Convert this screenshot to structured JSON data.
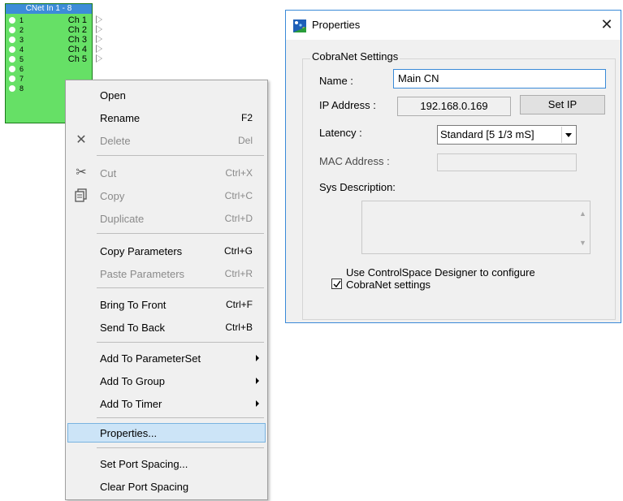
{
  "block": {
    "title": "CNet In 1 - 8",
    "ports": [
      {
        "num": "1",
        "out": "Ch 1"
      },
      {
        "num": "2",
        "out": "Ch 2"
      },
      {
        "num": "3",
        "out": "Ch 3"
      },
      {
        "num": "4",
        "out": "Ch 4"
      },
      {
        "num": "5",
        "out": "Ch 5"
      },
      {
        "num": "6",
        "out": ""
      },
      {
        "num": "7",
        "out": ""
      },
      {
        "num": "8",
        "out": ""
      }
    ]
  },
  "menu": {
    "open": "Open",
    "rename": "Rename",
    "rename_sc": "F2",
    "delete": "Delete",
    "delete_sc": "Del",
    "cut": "Cut",
    "cut_sc": "Ctrl+X",
    "copy": "Copy",
    "copy_sc": "Ctrl+C",
    "duplicate": "Duplicate",
    "duplicate_sc": "Ctrl+D",
    "copy_params": "Copy Parameters",
    "copy_params_sc": "Ctrl+G",
    "paste_params": "Paste Parameters",
    "paste_params_sc": "Ctrl+R",
    "bring_front": "Bring To Front",
    "bring_front_sc": "Ctrl+F",
    "send_back": "Send To Back",
    "send_back_sc": "Ctrl+B",
    "add_paramset": "Add To ParameterSet",
    "add_group": "Add To Group",
    "add_timer": "Add To Timer",
    "properties": "Properties...",
    "set_spacing": "Set Port Spacing...",
    "clear_spacing": "Clear Port Spacing"
  },
  "dialog": {
    "title": "Properties",
    "close": "✕",
    "group_label": "CobraNet Settings",
    "name_label": "Name :",
    "name_value": "Main CN",
    "ip_label": "IP Address :",
    "ip_value": "192.168.0.169",
    "set_ip": "Set IP",
    "latency_label": "Latency :",
    "latency_value": "Standard [5 1/3 mS]",
    "mac_label": "MAC Address :",
    "mac_value": "",
    "sysdesc_label": "Sys Description:",
    "sysdesc_value": "",
    "checkbox_label_1": "Use ControlSpace Designer to configure",
    "checkbox_label_2": "CobraNet settings",
    "checkbox_checked": true
  },
  "colors": {
    "block_green": "#66e066",
    "block_title_blue": "#3c8cd8",
    "menu_highlight": "#cce4f7",
    "dialog_border": "#3a8ad8"
  }
}
